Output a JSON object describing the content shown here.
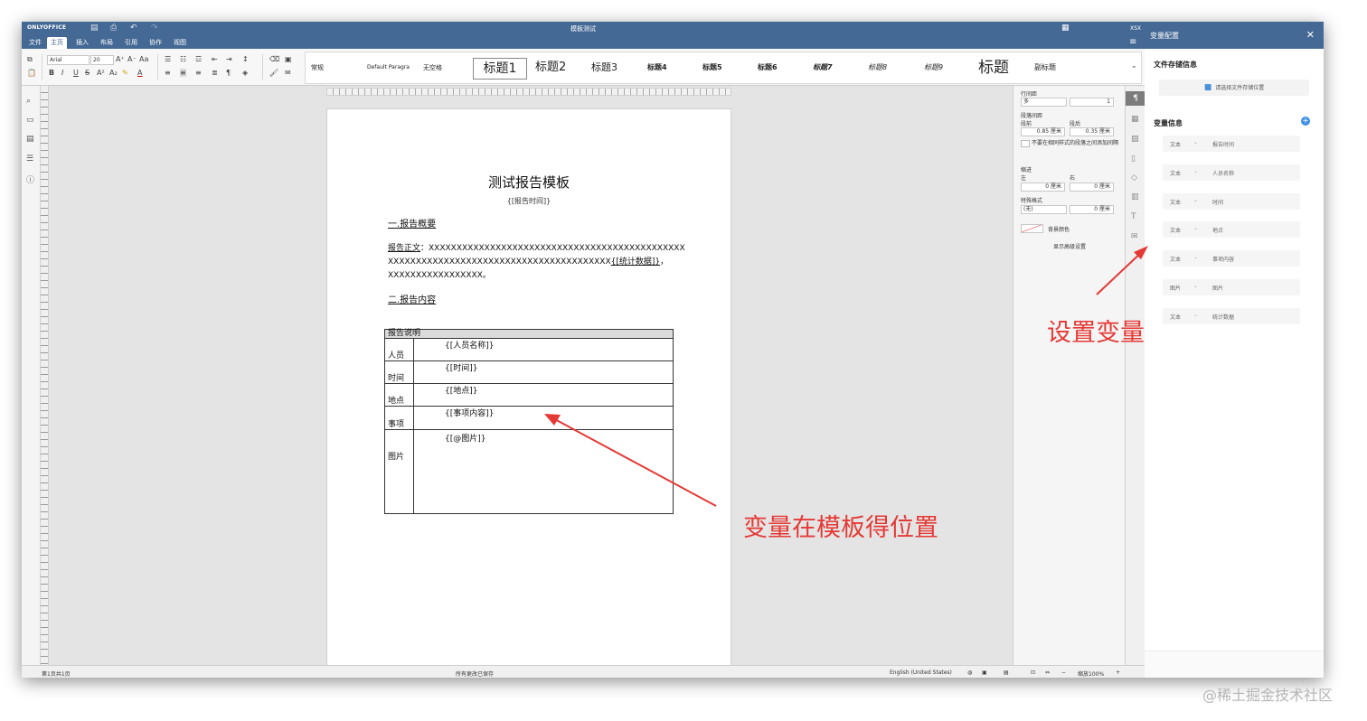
{
  "app": {
    "logo": "ONLYOFFICE",
    "doc_title": "模板测试",
    "file_badge": "XSX"
  },
  "menu": {
    "tabs": [
      "文件",
      "主页",
      "插入",
      "布局",
      "引用",
      "协作",
      "视图"
    ],
    "active_tab": "主页"
  },
  "toolbar": {
    "font_name": "Arial",
    "font_size": "20",
    "styles": [
      "常规",
      "Default Paragra",
      "无空格",
      "标题1",
      "标题2",
      "标题3",
      "标题4",
      "标题5",
      "标题6",
      "标题7",
      "标题8",
      "标题9",
      "标题",
      "副标题"
    ],
    "selected_style": "标题1"
  },
  "document": {
    "heading": "测试报告模板",
    "subheading": "{[报告时间]}",
    "section1": "一.报告概要",
    "body_label": "报告正文",
    "body_line1": "：XXXXXXXXXXXXXXXXXXXXXXXXXXXXXXXXXXXXXXXXXXXXXX",
    "body_line2a": "XXXXXXXXXXXXXXXXXXXXXXXXXXXXXXXXXXXXXXXX",
    "body_var": "{[统计数据]}",
    "body_line2b": "，",
    "body_line3": "XXXXXXXXXXXXXXXXX。",
    "section2": "二.报告内容",
    "table": {
      "header": "报告说明",
      "rows": [
        {
          "label": "人员",
          "value": "{[人员名称]}"
        },
        {
          "label": "时间",
          "value": "{[时间]}"
        },
        {
          "label": "地点",
          "value": "{[地点]}"
        },
        {
          "label": "事项",
          "value": "{[事项内容]}"
        },
        {
          "label": "图片",
          "value": "{[@图片]}"
        }
      ]
    }
  },
  "paragraph_panel": {
    "line_spacing_label": "行间距",
    "line_spacing_type": "多",
    "line_spacing_value": "1",
    "para_spacing_label": "段落间距",
    "before_label": "段前",
    "after_label": "段后",
    "before_value": "0.85 厘米",
    "after_value": "0.35 厘米",
    "no_spacing_checkbox": "不要在相同样式的段落之间添加间隔",
    "indent_label": "缩进",
    "left_label": "左",
    "right_label": "右",
    "left_value": "0 厘米",
    "right_value": "0 厘米",
    "special_label": "特殊格式",
    "special_value": "(无)",
    "special_amount": "0 厘米",
    "background_label": "背景颜色",
    "advanced_link": "显示高级设置"
  },
  "statusbar": {
    "page_info": "第1页共1页",
    "save_status": "所有更改已保存",
    "language": "English (United States)",
    "zoom": "缩放100%"
  },
  "var_panel": {
    "title": "变量配置",
    "storage_section": "文件存储信息",
    "storage_button": "请选择文件存储位置",
    "vars_section": "变量信息",
    "variables": [
      {
        "type": "文本",
        "name": "报告时间"
      },
      {
        "type": "文本",
        "name": "人员名称"
      },
      {
        "type": "文本",
        "name": "时间"
      },
      {
        "type": "文本",
        "name": "地点"
      },
      {
        "type": "文本",
        "name": "事项内容"
      },
      {
        "type": "图片",
        "name": "图片"
      },
      {
        "type": "文本",
        "name": "统计数据"
      }
    ]
  },
  "annotations": {
    "set_variable": "设置变量",
    "variable_position": "变量在模板得位置",
    "color": "#e53935"
  },
  "watermark": "@稀土掘金技术社区",
  "colors": {
    "brand": "#446995",
    "accent_blue": "#3d8fe3"
  }
}
